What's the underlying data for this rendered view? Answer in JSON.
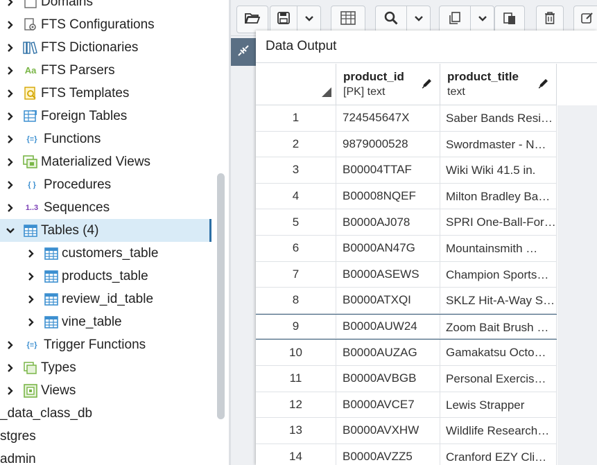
{
  "tree": {
    "items": [
      {
        "label": "Domains",
        "icon": "domains-icon",
        "indent": 1
      },
      {
        "label": "FTS Configurations",
        "icon": "fts-configuration-icon",
        "indent": 1
      },
      {
        "label": "FTS Dictionaries",
        "icon": "fts-dictionary-icon",
        "indent": 1
      },
      {
        "label": "FTS Parsers",
        "icon": "fts-parser-icon",
        "indent": 1,
        "glyph": "Aa"
      },
      {
        "label": "FTS Templates",
        "icon": "fts-template-icon",
        "indent": 1
      },
      {
        "label": "Foreign Tables",
        "icon": "foreign-table-icon",
        "indent": 1
      },
      {
        "label": "Functions",
        "icon": "function-icon",
        "indent": 1,
        "glyph": "{≡}"
      },
      {
        "label": "Materialized Views",
        "icon": "materialized-view-icon",
        "indent": 1
      },
      {
        "label": "Procedures",
        "icon": "procedure-icon",
        "indent": 1,
        "glyph": "{ }"
      },
      {
        "label": "Sequences",
        "icon": "sequence-icon",
        "indent": 1,
        "glyph": "1..3"
      },
      {
        "label": "Tables (4)",
        "icon": "table-icon",
        "indent": 1,
        "expanded": true,
        "selected": true
      },
      {
        "label": "customers_table",
        "icon": "table-icon",
        "indent": 2
      },
      {
        "label": "products_table",
        "icon": "table-icon",
        "indent": 2
      },
      {
        "label": "review_id_table",
        "icon": "table-icon",
        "indent": 2
      },
      {
        "label": "vine_table",
        "icon": "table-icon",
        "indent": 2
      },
      {
        "label": "Trigger Functions",
        "icon": "trigger-function-icon",
        "indent": 1,
        "glyph": "{≡}"
      },
      {
        "label": "Types",
        "icon": "type-icon",
        "indent": 1
      },
      {
        "label": "Views",
        "icon": "view-icon",
        "indent": 1
      },
      {
        "label": "_data_class_db",
        "icon": "",
        "indent": 0
      },
      {
        "label": "stgres",
        "icon": "",
        "indent": 0
      },
      {
        "label": "admin",
        "icon": "",
        "indent": 0
      }
    ]
  },
  "toolbar": {
    "buttons": [
      "open-file-icon",
      "save-icon",
      "save-dropdown-icon",
      "load-table-icon",
      "search-icon",
      "search-dropdown-icon",
      "copy-icon",
      "copy-dropdown-icon",
      "paste-icon",
      "delete-icon",
      "edit-icon"
    ]
  },
  "data_output": {
    "title": "Data Output",
    "columns": [
      {
        "name": "product_id",
        "type": "[PK] text"
      },
      {
        "name": "product_title",
        "type": "text"
      }
    ],
    "rows": [
      {
        "n": "1",
        "product_id": "724545647X",
        "product_title": "Saber Bands Resi…"
      },
      {
        "n": "2",
        "product_id": "9879000528",
        "product_title": "Swordmaster - N…"
      },
      {
        "n": "3",
        "product_id": "B00004TTAF",
        "product_title": "Wiki Wiki 41.5 in."
      },
      {
        "n": "4",
        "product_id": "B00008NQEF",
        "product_title": "Milton Bradley Ba…"
      },
      {
        "n": "5",
        "product_id": "B0000AJ078",
        "product_title": "SPRI One-Ball-For…"
      },
      {
        "n": "6",
        "product_id": "B0000AN47G",
        "product_title": "Mountainsmith …"
      },
      {
        "n": "7",
        "product_id": "B0000ASEWS",
        "product_title": "Champion Sports…"
      },
      {
        "n": "8",
        "product_id": "B0000ATXQI",
        "product_title": "SKLZ Hit-A-Way S…"
      },
      {
        "n": "9",
        "product_id": "B0000AUW24",
        "product_title": "Zoom Bait Brush …"
      },
      {
        "n": "10",
        "product_id": "B0000AUZAG",
        "product_title": "Gamakatsu Octo…"
      },
      {
        "n": "11",
        "product_id": "B0000AVBGB",
        "product_title": "Personal Exercis…"
      },
      {
        "n": "12",
        "product_id": "B0000AVCE7",
        "product_title": "Lewis Strapper"
      },
      {
        "n": "13",
        "product_id": "B0000AVXHW",
        "product_title": "Wildlife Research…"
      },
      {
        "n": "14",
        "product_id": "B0000AVZZ5",
        "product_title": "Cranford EZY Cli…"
      }
    ]
  },
  "colors": {
    "selected_bg": "#d9ebf7",
    "selected_border": "#2c6fa5",
    "icon_green": "#7ab648",
    "icon_blue": "#3c8fd0"
  }
}
